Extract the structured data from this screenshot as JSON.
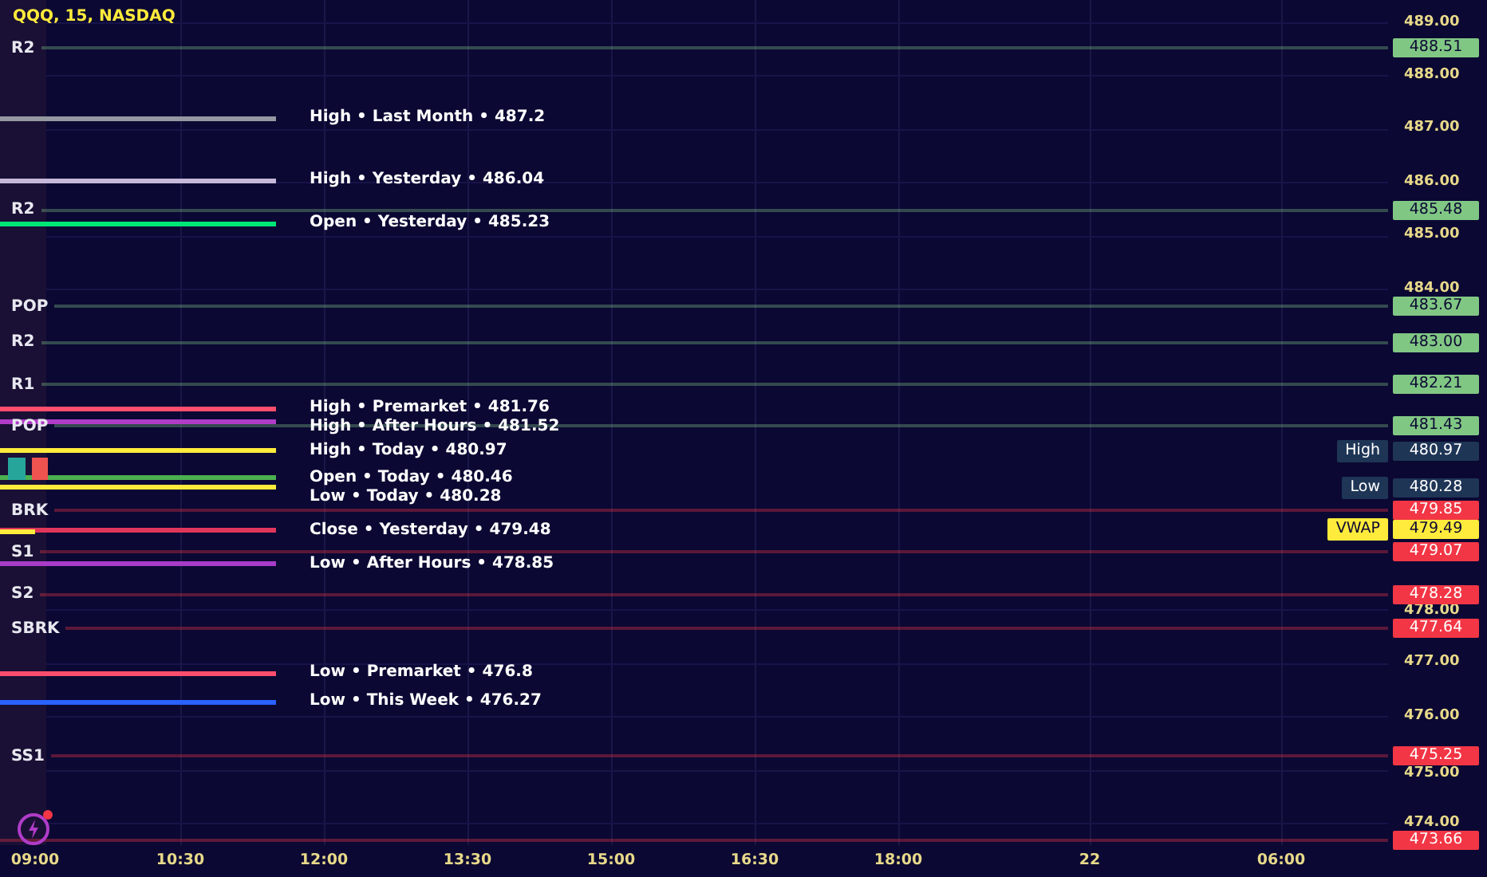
{
  "chart": {
    "title": "QQQ, 15, NASDAQ"
  },
  "price_axis": [
    "489.00",
    "488.00",
    "487.00",
    "486.00",
    "485.00",
    "484.00",
    "478.00",
    "477.00",
    "476.00",
    "475.00",
    "474.00"
  ],
  "time_axis": [
    "09:00",
    "10:30",
    "12:00",
    "13:30",
    "15:00",
    "16:30",
    "18:00",
    "22",
    "06:00"
  ],
  "pivots": [
    {
      "label": "R2",
      "price": "488.51",
      "color": "#81c784"
    },
    {
      "label": "R2",
      "price": "485.48",
      "color": "#81c784"
    },
    {
      "label": "POP",
      "price": "483.67",
      "color": "#81c784"
    },
    {
      "label": "R2",
      "price": "483.00",
      "color": "#81c784"
    },
    {
      "label": "R1",
      "price": "482.21",
      "color": "#81c784"
    },
    {
      "label": "POP",
      "price": "481.43",
      "color": "#81c784"
    },
    {
      "label": "BRK",
      "price": "479.85",
      "color": "#f23645"
    },
    {
      "label": "S1",
      "price": "479.07",
      "color": "#f23645"
    },
    {
      "label": "S2",
      "price": "478.28",
      "color": "#f23645"
    },
    {
      "label": "SBRK",
      "price": "477.64",
      "color": "#f23645"
    },
    {
      "label": "SS1",
      "price": "475.25",
      "color": "#f23645"
    },
    {
      "price": "473.66",
      "color": "#f23645"
    }
  ],
  "session_levels": [
    {
      "label": "High • Last Month • 487.2",
      "color": "#9598a1"
    },
    {
      "label": "High • Yesterday • 486.04",
      "color": "#c5b8d8"
    },
    {
      "label": "Open • Yesterday • 485.23",
      "color": "#00e676"
    },
    {
      "label": "High • Premarket • 481.76",
      "color": "#ff4d6d"
    },
    {
      "label": "High • After Hours • 481.52",
      "color": "#b03cc8"
    },
    {
      "label": "High • Today • 480.97",
      "color": "#ffeb3b"
    },
    {
      "label": "Open • Today • 480.46",
      "color": "#4caf50"
    },
    {
      "label": "Low • Today • 480.28",
      "color": "#ffeb3b"
    },
    {
      "label": "Close • Yesterday • 479.48",
      "color": "#e0365a"
    },
    {
      "label": "Low • After Hours • 478.85",
      "color": "#a83cc8"
    },
    {
      "label": "Low • Premarket • 476.8",
      "color": "#ff4d6d"
    },
    {
      "label": "Low • This Week • 476.27",
      "color": "#2962ff"
    }
  ],
  "markers": [
    {
      "label": "High",
      "price": "480.97",
      "color": "#1e3556"
    },
    {
      "label": "Low",
      "price": "480.28",
      "color": "#1e3556"
    },
    {
      "label": "VWAP",
      "price": "479.49",
      "color": "#ffeb3b"
    }
  ]
}
